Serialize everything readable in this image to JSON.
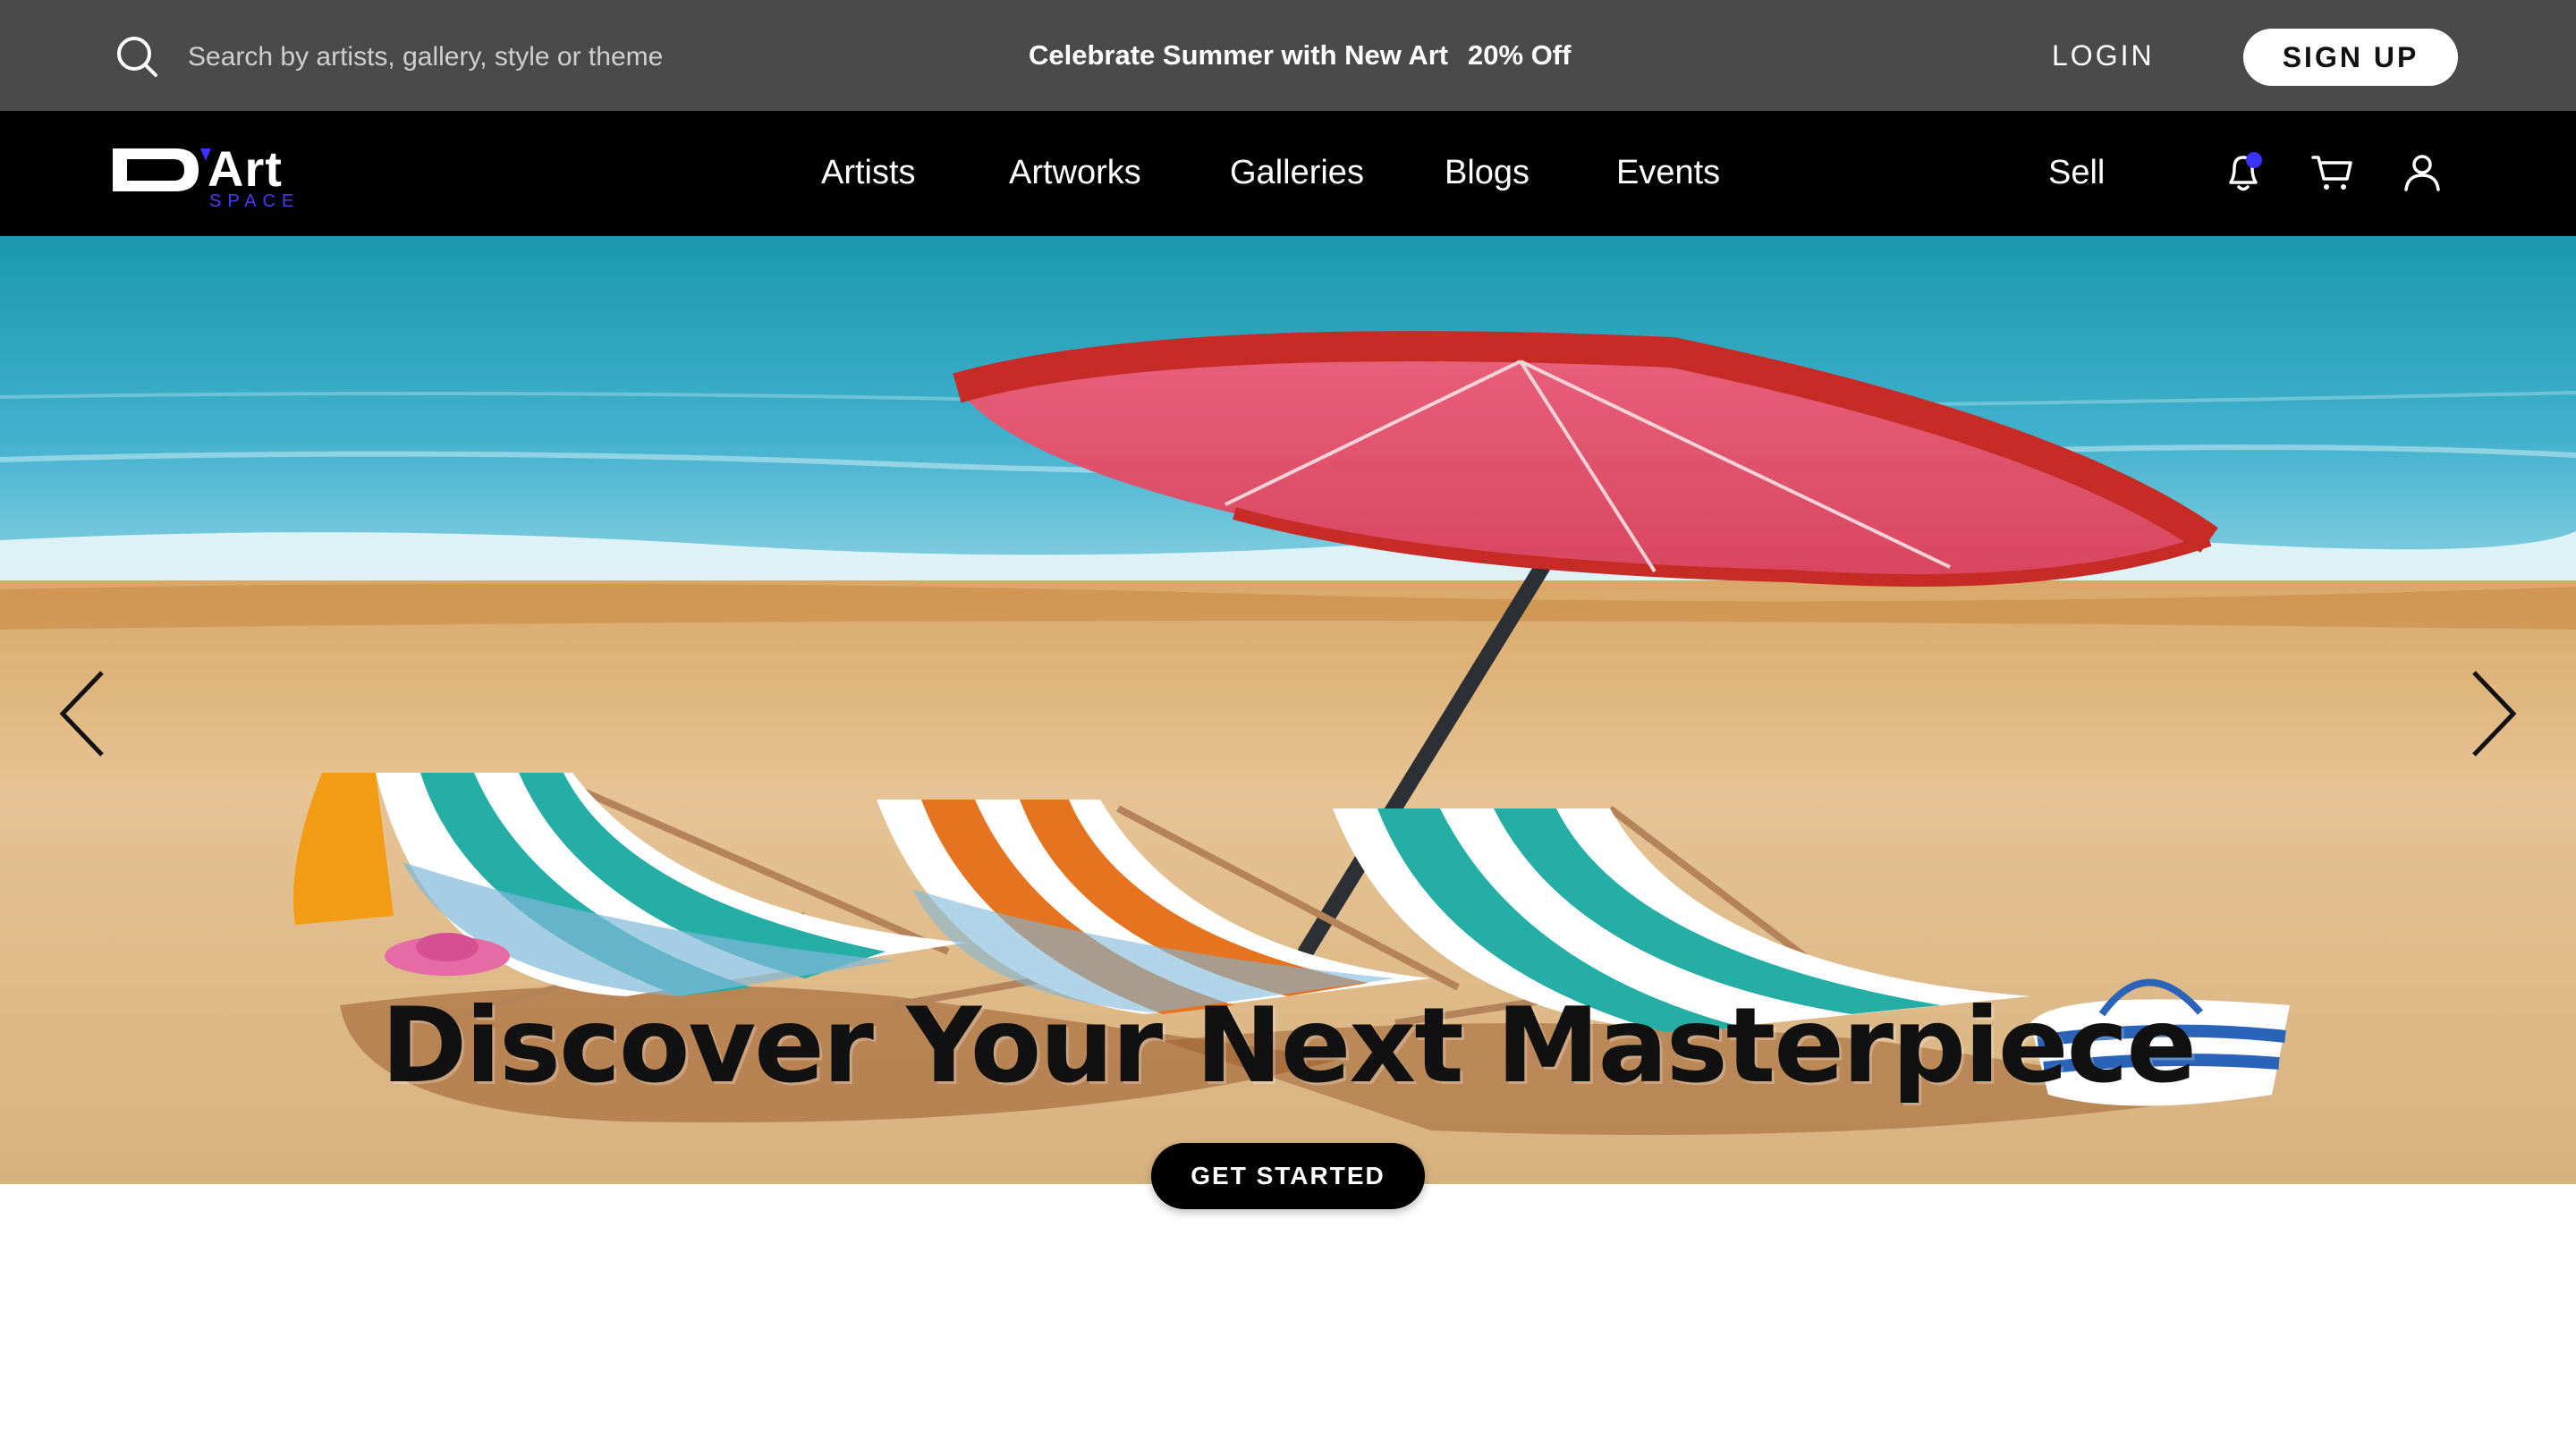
{
  "promo_bar": {
    "search_placeholder": "Search by artists, gallery, style or theme",
    "promo_text": "Celebrate Summer with New Art",
    "promo_discount": "20% Off",
    "login_label": "LOGIN",
    "signup_label": "SIGN UP"
  },
  "nav": {
    "logo_word": "Art",
    "logo_sub": "SPACE",
    "links": [
      {
        "label": "Artists"
      },
      {
        "label": "Artworks"
      },
      {
        "label": "Galleries"
      },
      {
        "label": "Blogs"
      },
      {
        "label": "Events"
      }
    ],
    "sell_label": "Sell",
    "icons": [
      "bell-icon",
      "cart-icon",
      "user-icon"
    ]
  },
  "hero": {
    "title": "Discover Your Next Masterpiece",
    "cta_label": "GET STARTED",
    "prev_icon": "chevron-left-icon",
    "next_icon": "chevron-right-icon"
  },
  "colors": {
    "promo_bg": "#4a4a4a",
    "nav_bg": "#000000",
    "accent": "#3a32ff"
  }
}
